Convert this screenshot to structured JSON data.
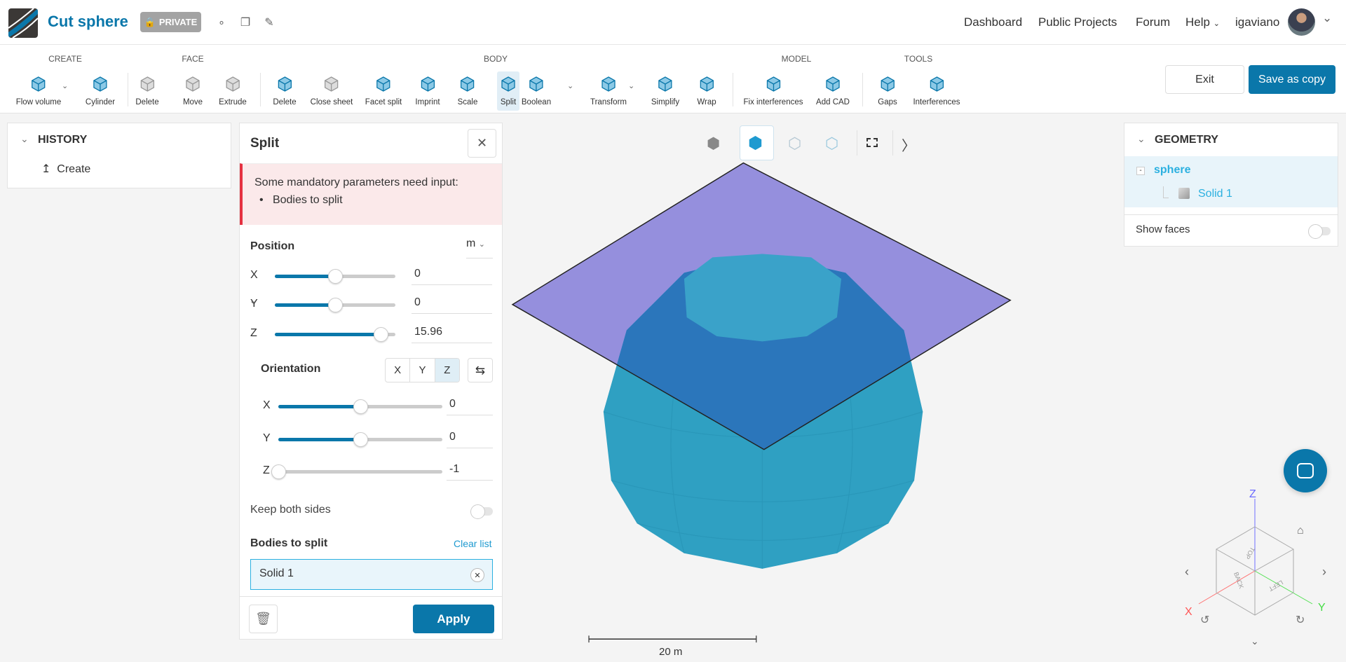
{
  "header": {
    "title": "Cut sphere",
    "badge": "PRIVATE",
    "nav": [
      "Dashboard",
      "Public Projects",
      "Forum",
      "Help"
    ],
    "user": "igaviano"
  },
  "toolbar": {
    "groups": [
      "CREATE",
      "FACE",
      "BODY",
      "MODEL",
      "TOOLS"
    ],
    "create": [
      "Flow volume",
      "Cylinder"
    ],
    "face": [
      "Delete",
      "Move",
      "Extrude"
    ],
    "body": [
      "Delete",
      "Close sheet",
      "Facet split",
      "Imprint",
      "Scale",
      "Split",
      "Boolean",
      "Transform",
      "Simplify",
      "Wrap"
    ],
    "model": [
      "Fix interferences",
      "Add CAD"
    ],
    "tools": [
      "Gaps",
      "Interferences"
    ],
    "exit": "Exit",
    "save": "Save as copy"
  },
  "history": {
    "title": "HISTORY",
    "items": [
      "Create"
    ]
  },
  "split": {
    "title": "Split",
    "error": {
      "message": "Some mandatory parameters need input:",
      "items": [
        "Bodies to split"
      ]
    },
    "position": {
      "label": "Position",
      "unit": "m",
      "axes": [
        {
          "label": "X",
          "value": "0",
          "fraction": 0.5
        },
        {
          "label": "Y",
          "value": "0",
          "fraction": 0.5
        },
        {
          "label": "Z",
          "value": "15.96",
          "fraction": 0.88
        }
      ]
    },
    "orientation": {
      "label": "Orientation",
      "buttons": [
        "X",
        "Y",
        "Z"
      ],
      "selected": "Z",
      "axes": [
        {
          "label": "X",
          "value": "0",
          "fraction": 0.5
        },
        {
          "label": "Y",
          "value": "0",
          "fraction": 0.5
        },
        {
          "label": "Z",
          "value": "-1",
          "fraction": 0.0
        }
      ]
    },
    "keep_both": "Keep both sides",
    "bodies_label": "Bodies to split",
    "clear": "Clear list",
    "bodies": [
      "Solid 1"
    ],
    "apply": "Apply"
  },
  "geometry": {
    "title": "GEOMETRY",
    "root": "sphere",
    "child": "Solid 1",
    "show_faces": "Show faces"
  },
  "viewport": {
    "scale": "20 m",
    "cube": {
      "top": "TOP",
      "back": "BACK",
      "left": "LEFT",
      "x": "X",
      "y": "Y",
      "z": "Z"
    }
  },
  "colors": {
    "accent": "#0a77aa",
    "plane": "#8f8ae0",
    "body": "#2f9fc2",
    "error": "#e53040"
  }
}
